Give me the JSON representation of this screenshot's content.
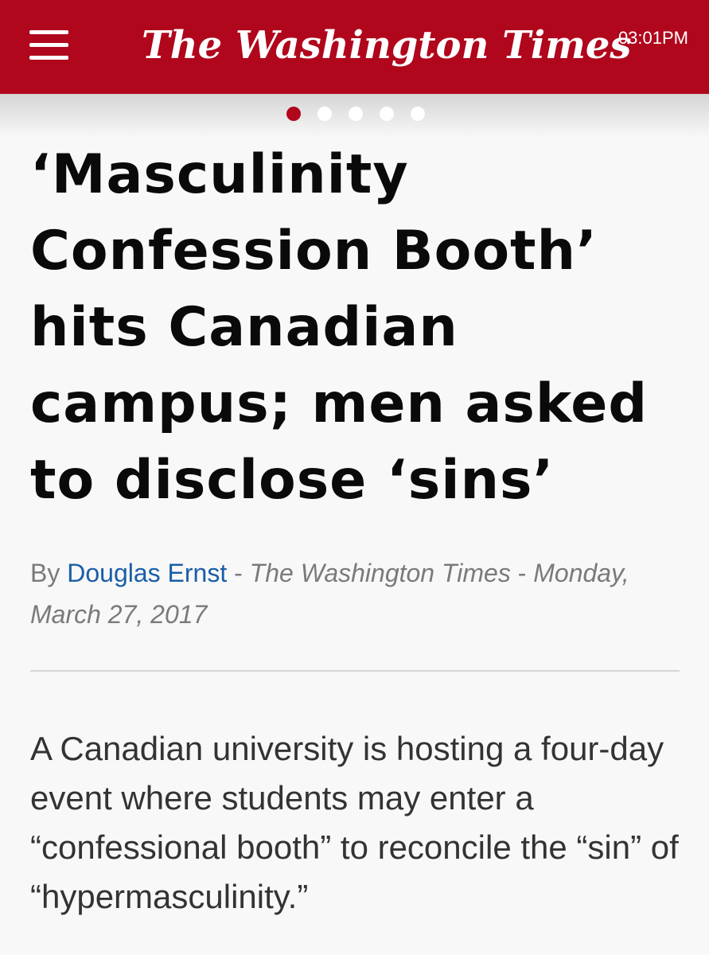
{
  "header": {
    "logo_text": "The Washington Times",
    "time": "03:01PM",
    "menu_icon": "hamburger-menu-icon",
    "background_color": "#b0071c"
  },
  "pager": {
    "count": 5,
    "active_index": 0
  },
  "article": {
    "headline": "‘Masculinity Confession Booth’ hits Canadian campus; men asked to disclose ‘sins’",
    "byline": {
      "prefix": "By",
      "author": "Douglas Ernst",
      "separator_1": "-",
      "publication": "The Washington Times",
      "separator_2": "-",
      "date": "Monday, March 27, 2017"
    },
    "lede": "A Canadian university is hosting a four-day event where students may enter a “confessional booth” to reconcile the “sin” of “hypermasculinity.”"
  }
}
